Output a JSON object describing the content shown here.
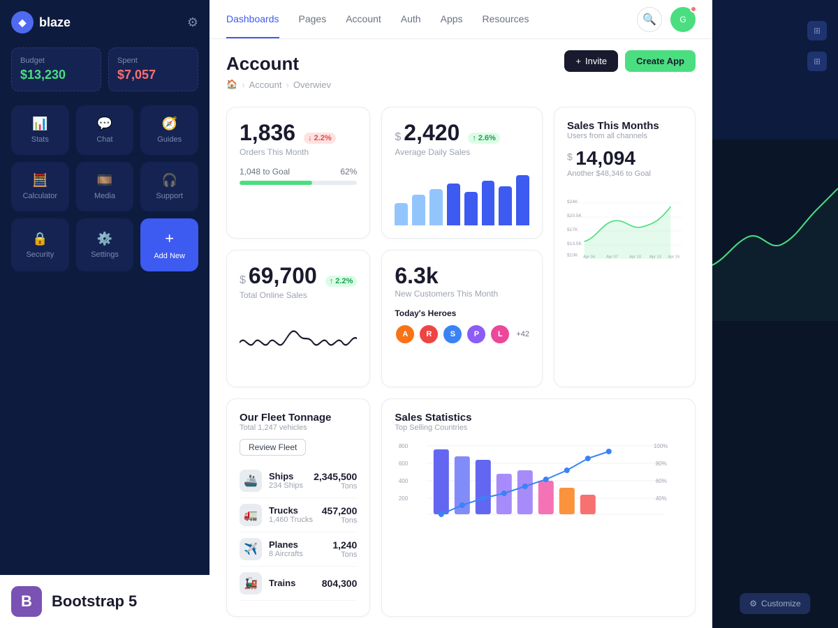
{
  "app": {
    "name": "blaze"
  },
  "sidebar": {
    "budget_label": "Budget",
    "budget_value": "$13,230",
    "spent_label": "Spent",
    "spent_value": "$7,057",
    "nav_items": [
      {
        "id": "stats",
        "label": "Stats",
        "icon": "📊"
      },
      {
        "id": "chat",
        "label": "Chat",
        "icon": "💬"
      },
      {
        "id": "guides",
        "label": "Guides",
        "icon": "🧭"
      },
      {
        "id": "calculator",
        "label": "Calculator",
        "icon": "🧮"
      },
      {
        "id": "media",
        "label": "Media",
        "icon": "🎞️"
      },
      {
        "id": "support",
        "label": "Support",
        "icon": "🎧"
      },
      {
        "id": "security",
        "label": "Security",
        "icon": "🔒"
      },
      {
        "id": "settings",
        "label": "Settings",
        "icon": "⚙️"
      },
      {
        "id": "add-new",
        "label": "Add New",
        "icon": "+"
      }
    ],
    "bootstrap_label": "Bootstrap 5",
    "bootstrap_icon": "B"
  },
  "top_nav": {
    "items": [
      {
        "id": "dashboards",
        "label": "Dashboards",
        "active": true
      },
      {
        "id": "pages",
        "label": "Pages"
      },
      {
        "id": "account",
        "label": "Account"
      },
      {
        "id": "auth",
        "label": "Auth"
      },
      {
        "id": "apps",
        "label": "Apps"
      },
      {
        "id": "resources",
        "label": "Resources"
      }
    ]
  },
  "page": {
    "title": "Account",
    "breadcrumb": [
      "🏠",
      "Account",
      "Overwiev"
    ],
    "actions": {
      "invite_label": "Invite",
      "create_label": "Create App"
    }
  },
  "stats": {
    "orders": {
      "value": "1,836",
      "label": "Orders This Month",
      "change": "2.2%",
      "change_type": "down",
      "progress_label": "1,048 to Goal",
      "progress_pct": "62%",
      "progress_value": 62
    },
    "daily_sales": {
      "prefix": "$",
      "value": "2,420",
      "label": "Average Daily Sales",
      "change": "2.6%",
      "change_type": "up",
      "bars": [
        40,
        55,
        65,
        75,
        60,
        80,
        70,
        85
      ]
    },
    "sales_month": {
      "title": "Sales This Months",
      "subtitle": "Users from all channels",
      "prefix": "$",
      "value": "14,094",
      "goal_label": "Another $48,346 to Goal",
      "y_labels": [
        "$24K",
        "$20.5K",
        "$17K",
        "$13.5K",
        "$10K"
      ],
      "x_labels": [
        "Apr 04",
        "Apr 07",
        "Apr 10",
        "Apr 13",
        "Apr 16"
      ]
    },
    "online_sales": {
      "prefix": "$",
      "value": "69,700",
      "label": "Total Online Sales",
      "change": "2.2%",
      "change_type": "up"
    },
    "new_customers": {
      "value": "6.3k",
      "label": "New Customers This Month",
      "heroes_title": "Today's Heroes",
      "hero_count": "+42"
    }
  },
  "fleet": {
    "title": "Our Fleet Tonnage",
    "subtitle": "Total 1,247 vehicles",
    "review_btn": "Review Fleet",
    "items": [
      {
        "name": "Ships",
        "count": "234 Ships",
        "value": "2,345,500",
        "unit": "Tons",
        "icon": "🚢"
      },
      {
        "name": "Trucks",
        "count": "1,460 Trucks",
        "value": "457,200",
        "unit": "Tons",
        "icon": "🚛"
      },
      {
        "name": "Planes",
        "count": "8 Aircrafts",
        "value": "1,240",
        "unit": "Tons",
        "icon": "✈️"
      },
      {
        "name": "Trains",
        "count": "",
        "value": "804,300",
        "unit": "",
        "icon": "🚂"
      }
    ]
  },
  "sales_statistics": {
    "title": "Sales Statistics",
    "subtitle": "Top Selling Countries",
    "y_labels": [
      "800",
      "600",
      "400",
      "200"
    ],
    "pct_labels": [
      "100%",
      "80%",
      "60%",
      "40%"
    ]
  },
  "right_panel": {
    "customize_label": "Customize"
  },
  "heroes": [
    {
      "color": "#f97316",
      "initial": "A"
    },
    {
      "color": "#ef4444",
      "initial": "R"
    },
    {
      "color": "#3b82f6",
      "initial": "S"
    },
    {
      "color": "#8b5cf6",
      "initial": "P"
    },
    {
      "color": "#ec4899",
      "initial": "L"
    }
  ]
}
